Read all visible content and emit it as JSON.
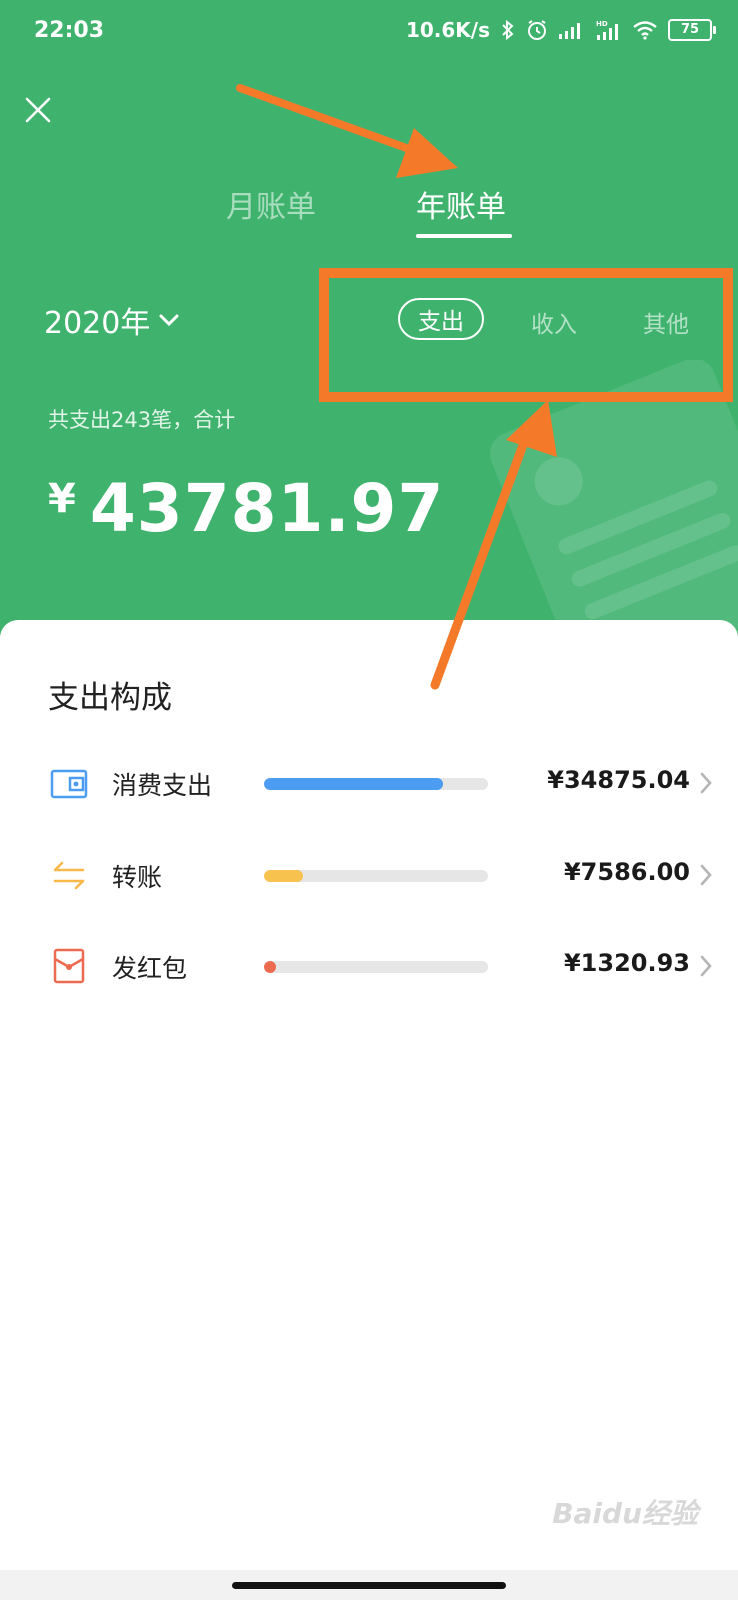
{
  "status_bar": {
    "time": "22:03",
    "speed": "10.6K/s",
    "battery": "75"
  },
  "tabs": [
    {
      "label": "月账单",
      "active": false
    },
    {
      "label": "年账单",
      "active": true
    }
  ],
  "year_selector": {
    "label": "2020年"
  },
  "segments": [
    {
      "label": "支出",
      "active": true
    },
    {
      "label": "收入",
      "active": false
    },
    {
      "label": "其他",
      "active": false
    }
  ],
  "summary": {
    "text": "共支出243笔，合计",
    "currency": "¥",
    "total": "43781.97"
  },
  "breakdown": {
    "title": "支出构成",
    "items": [
      {
        "icon": "wallet-icon",
        "label": "消费支出",
        "amount": "¥34875.04",
        "share": 0.797,
        "color": "#4c9cf2"
      },
      {
        "icon": "transfer-icon",
        "label": "转账",
        "amount": "¥7586.00",
        "share": 0.173,
        "color": "#f8c24f"
      },
      {
        "icon": "red-envelope-icon",
        "label": "发红包",
        "amount": "¥1320.93",
        "share": 0.03,
        "color": "#ec6a4f"
      }
    ]
  },
  "colors": {
    "header_bg": "#3fb36e",
    "annotation": "#f47a2a",
    "text_dark": "#222222"
  },
  "watermark": "Baidu经验"
}
